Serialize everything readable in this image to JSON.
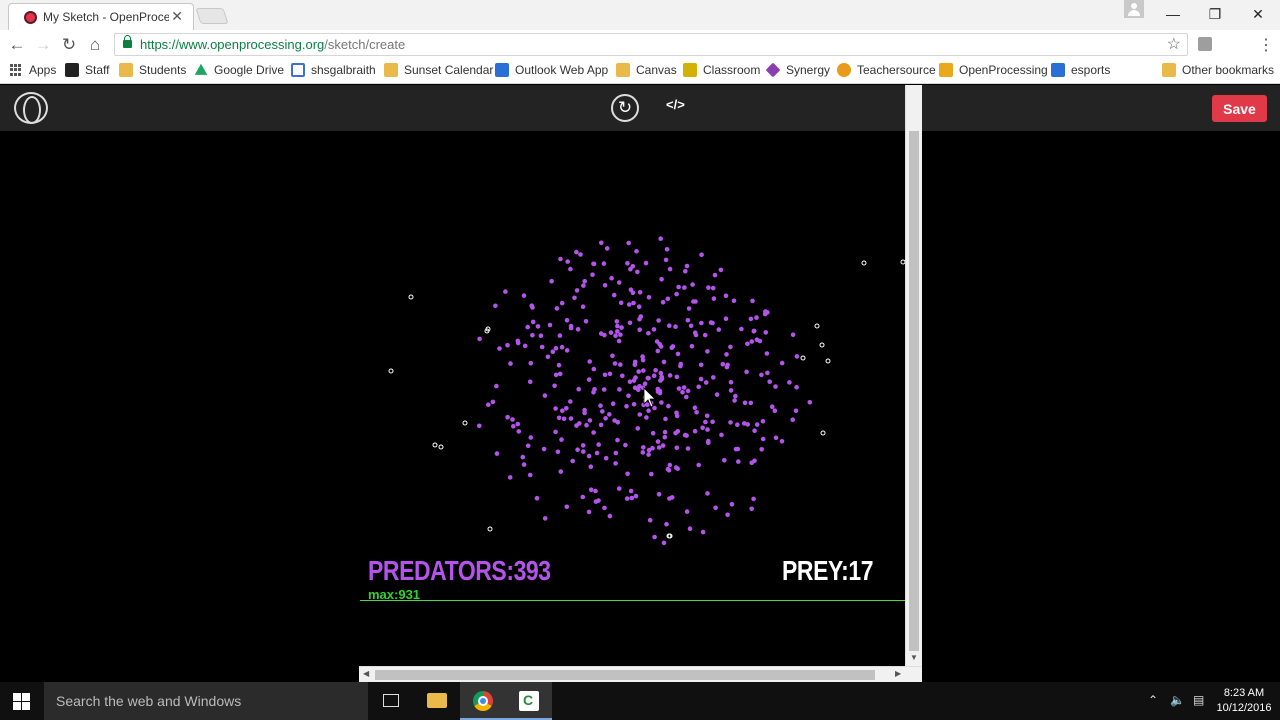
{
  "browser": {
    "tab_title": "My Sketch - OpenProcess",
    "tab_close": "✕",
    "url_host": "https://www.openprocessing.org",
    "url_path": "/sketch/create",
    "bookmarks": [
      {
        "label": "Apps",
        "icon": "apps-grid-icon",
        "color": "#555555"
      },
      {
        "label": "Staff",
        "icon": "staff-icon",
        "color": "#222222"
      },
      {
        "label": "Students",
        "icon": "students-icon",
        "color": "#e9b949"
      },
      {
        "label": "Google Drive",
        "icon": "google-drive-icon",
        "color": "#1fa463"
      },
      {
        "label": "shsgalbraith",
        "icon": "shsgalbraith-icon",
        "color": "#3d6fd6"
      },
      {
        "label": "Sunset Calendar",
        "icon": "sunset-calendar-icon",
        "color": "#e9b949"
      },
      {
        "label": "Outlook Web App",
        "icon": "outlook-icon",
        "color": "#2a6fd6"
      },
      {
        "label": "Canvas",
        "icon": "canvas-icon",
        "color": "#e9b949"
      },
      {
        "label": "Classroom",
        "icon": "classroom-icon",
        "color": "#d4b106"
      },
      {
        "label": "Synergy",
        "icon": "synergy-icon",
        "color": "#8a3fb0"
      },
      {
        "label": "Teachersource",
        "icon": "teachersource-icon",
        "color": "#e99a1a"
      },
      {
        "label": "OpenProcessing",
        "icon": "openprocessing-icon",
        "color": "#e9a91a"
      },
      {
        "label": "esports",
        "icon": "esports-icon",
        "color": "#2a6fd6"
      }
    ],
    "other_bookmarks": "Other bookmarks"
  },
  "editor": {
    "save_label": "Save",
    "replay_glyph": "↻",
    "code_glyph": "</>"
  },
  "sketch": {
    "predators_label": "PREDATORS:393",
    "prey_label": "PREY:17",
    "max_label": "max:931",
    "predator_color": "#b554ec",
    "prey_color": "#ffffff",
    "graph_color": "#4bd64b"
  },
  "taskbar": {
    "search_placeholder": "Search the web and Windows",
    "time": "8:23 AM",
    "date": "10/12/2016"
  }
}
